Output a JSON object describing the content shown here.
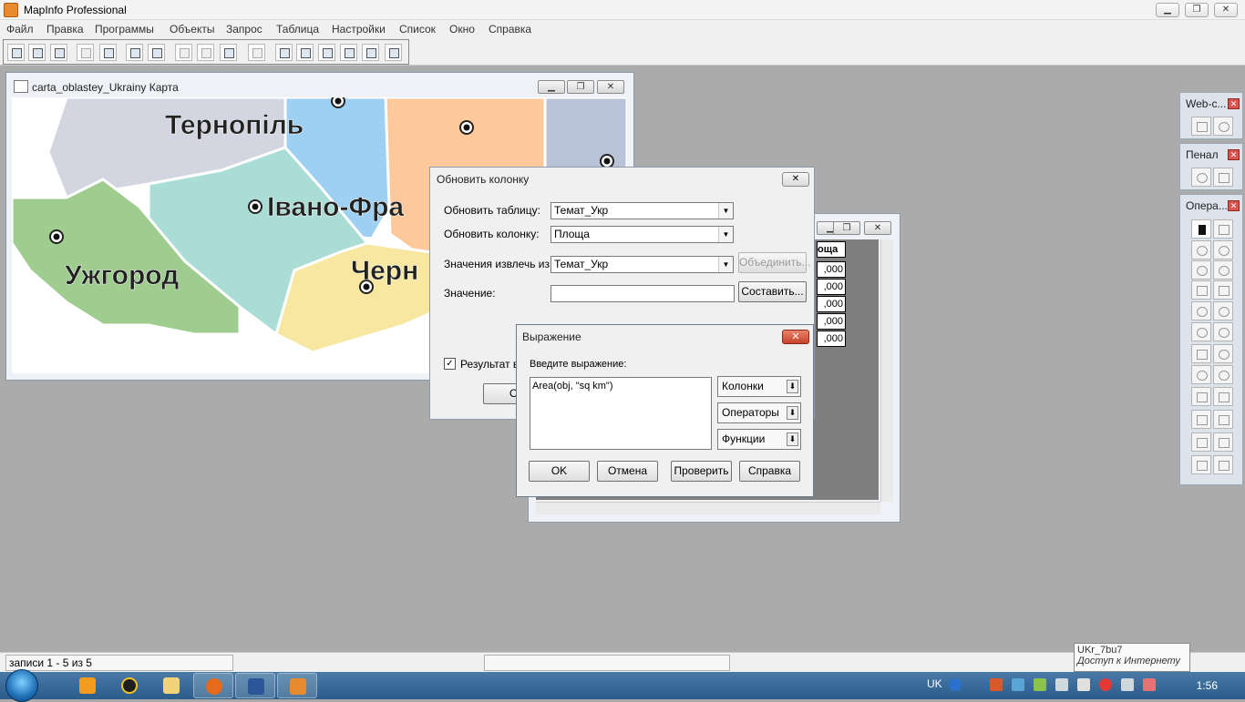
{
  "app": {
    "title": "MapInfo Professional"
  },
  "menu": [
    "Файл",
    "Правка",
    "Программы",
    "Объекты",
    "Запрос",
    "Таблица",
    "Настройки",
    "Список",
    "Окно",
    "Справка"
  ],
  "map_window": {
    "title": "carta_oblastey_Ukrainy Карта",
    "labels": [
      "Тернопіль",
      "Івано-Фра",
      "Ужгород",
      "Черн"
    ]
  },
  "browser_window": {
    "header": "оща",
    "values": [
      ",000",
      ",000",
      ",000",
      ",000",
      ",000"
    ]
  },
  "update_dialog": {
    "title": "Обновить колонку",
    "table_label": "Обновить таблицу:",
    "table_value": "Темат_Укр",
    "column_label": "Обновить колонку:",
    "column_value": "Площа",
    "source_label": "Значения извлечь из:",
    "source_value": "Темат_Укр",
    "join_button": "Объединить...",
    "value_label": "Значение:",
    "value_input": "",
    "assemble_button": "Составить...",
    "result_checkbox_label": "Результат в",
    "ok_partial": "О"
  },
  "expression_dialog": {
    "title": "Выражение",
    "prompt": "Введите выражение:",
    "expression": "Area(obj, \"sq km\")",
    "columns_dropdown": "Колонки",
    "operators_dropdown": "Операторы",
    "functions_dropdown": "Функции",
    "ok": "OK",
    "cancel": "Отмена",
    "verify": "Проверить",
    "help": "Справка"
  },
  "palettes": {
    "web": "Web-c...",
    "pen": "Пенал",
    "ops": "Опера..."
  },
  "status": {
    "records": "записи 1 - 5 из 5"
  },
  "tooltip": {
    "line1": "UKr_7bu7",
    "line2": "Доступ к Интернету"
  },
  "taskbar": {
    "language": "UK",
    "clock": "1:56"
  },
  "colors": {
    "oblast_ternopil": "#d3d6e0",
    "oblast_ivano": "#a9ddd6",
    "oblast_zakarpattia": "#9fcc8f",
    "oblast_lviv_blue": "#9dd0f2",
    "oblast_khmelnytskyi": "#fdc89a",
    "oblast_chernivtsi": "#f7e7a0",
    "taskbar": "#2b5d8a"
  }
}
